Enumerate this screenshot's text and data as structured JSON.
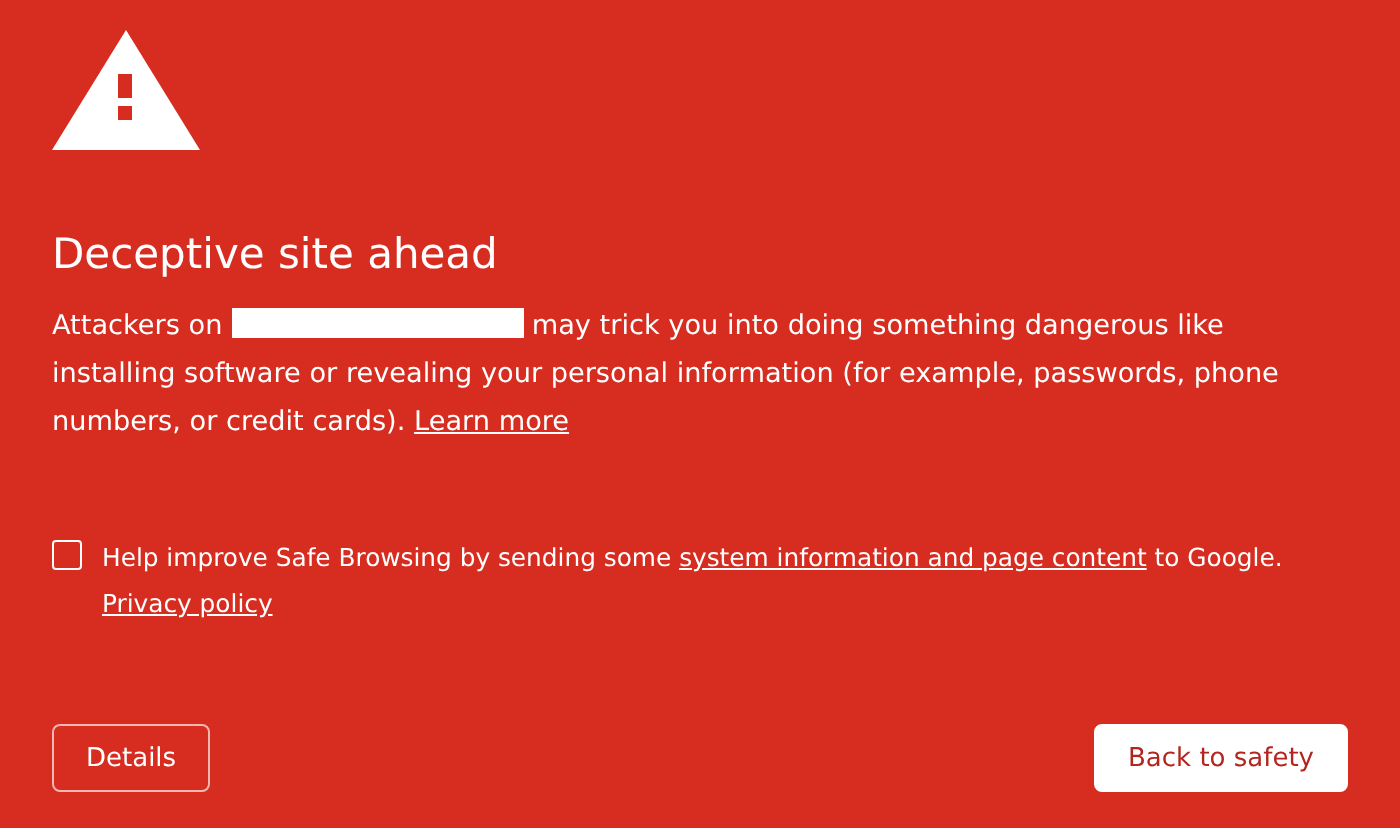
{
  "title": "Deceptive site ahead",
  "message": {
    "before": "Attackers on",
    "after": "may trick you into doing something dangerous like installing software or revealing your personal information (for example, passwords, phone numbers, or credit cards).",
    "link": "Learn more"
  },
  "consent": {
    "checked": false,
    "before": "Help improve Safe Browsing by sending some",
    "link": "system information and page content",
    "after": "to Google.",
    "privacy_link": "Privacy policy"
  },
  "buttons": [
    {
      "label": "Details",
      "kind": "secondary"
    },
    {
      "label": "Back to safety",
      "kind": "primary"
    }
  ]
}
